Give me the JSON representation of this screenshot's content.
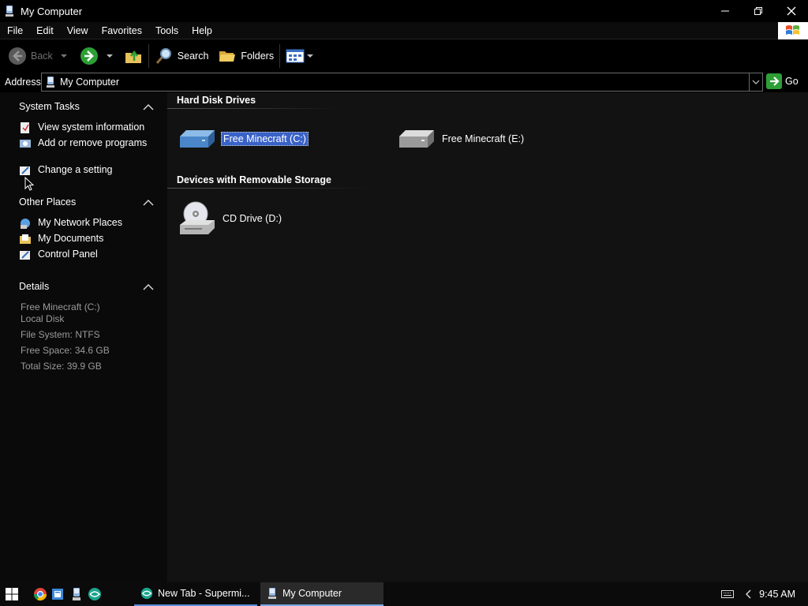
{
  "window": {
    "title": "My Computer"
  },
  "menu": [
    "File",
    "Edit",
    "View",
    "Favorites",
    "Tools",
    "Help"
  ],
  "toolbar": {
    "back_label": "Back",
    "search_label": "Search",
    "folders_label": "Folders"
  },
  "address": {
    "label": "Address",
    "value": "My Computer",
    "go_label": "Go"
  },
  "taskpane": {
    "system_tasks": {
      "title": "System Tasks",
      "items": [
        "View system information",
        "Add or remove programs",
        "Change a setting"
      ]
    },
    "other_places": {
      "title": "Other Places",
      "items": [
        "My Network Places",
        "My Documents",
        "Control Panel"
      ]
    },
    "details": {
      "title": "Details",
      "name": "Free Minecraft (C:)",
      "type": "Local Disk",
      "filesystem": "File System: NTFS",
      "free_space": "Free Space: 34.6 GB",
      "total_size": "Total Size: 39.9 GB"
    }
  },
  "content": {
    "hard_disk_title": "Hard Disk Drives",
    "drives": [
      {
        "label": "Free Minecraft (C:)",
        "selected": true
      },
      {
        "label": "Free Minecraft (E:)",
        "selected": false
      }
    ],
    "removable_title": "Devices with Removable Storage",
    "removable": [
      {
        "label": "CD Drive (D:)"
      }
    ]
  },
  "taskbar": {
    "tasks": [
      "New Tab - Supermi...",
      "My Computer"
    ],
    "clock": "9:45 AM"
  },
  "colors": {
    "selection": "#3a63c8",
    "go_green": "#2e9e36",
    "background": "#121212"
  }
}
